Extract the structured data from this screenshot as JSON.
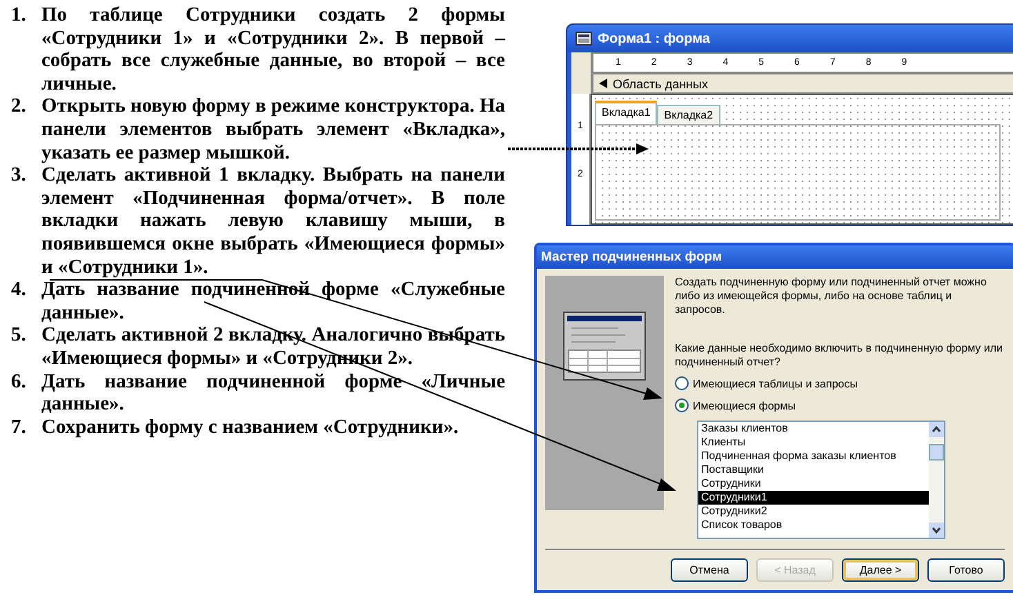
{
  "instructions": [
    {
      "number": "1.",
      "text": "По таблице Сотрудники создать 2 формы «Сотрудники 1» и «Сотрудники 2». В первой – собрать все служебные данные, во второй – все личные."
    },
    {
      "number": "2.",
      "text": "Открыть новую форму в режиме конструктора. На панели элементов выбрать элемент «Вкладка», указать ее размер мышкой."
    },
    {
      "number": "3.",
      "text": "Сделать активной 1 вкладку. Выбрать на панели элемент «Подчиненная форма/отчет». В поле вкладки нажать левую клавишу мыши, в появившемся окне выбрать «Имеющиеся формы» и «Сотрудники 1»."
    },
    {
      "number": "4.",
      "text": "Дать название подчиненной форме «Служебные данные»."
    },
    {
      "number": "5.",
      "text": "Сделать активной 2 вкладку. Аналогично выбрать «Имеющиеся формы» и «Сотрудники 2»."
    },
    {
      "number": "6.",
      "text": "Дать название подчиненной форме «Личные данные»."
    },
    {
      "number": "7.",
      "text": "Сохранить форму с названием «Сотрудники»."
    }
  ],
  "form_window": {
    "title": "Форма1 : форма",
    "ruler_marks": [
      "1",
      "2",
      "3",
      "4",
      "5",
      "6",
      "7",
      "8",
      "9"
    ],
    "vertical_marks": [
      "1",
      "2"
    ],
    "section": "Область данных",
    "tabs": [
      {
        "label": "Вкладка1",
        "selected": true
      },
      {
        "label": "Вкладка2",
        "selected": false
      }
    ]
  },
  "wizard": {
    "title": "Мастер подчиненных форм",
    "intro": "Создать подчиненную форму или подчиненный отчет можно либо из имеющейся формы, либо на основе таблиц и запросов.",
    "question": "Какие данные необходимо включить в подчиненную форму или подчиненный отчет?",
    "options": [
      {
        "label": "Имеющиеся таблицы и запросы",
        "selected": false
      },
      {
        "label": "Имеющиеся формы",
        "selected": true
      }
    ],
    "list_items": [
      {
        "label": "Заказы клиентов",
        "selected": false
      },
      {
        "label": "Клиенты",
        "selected": false
      },
      {
        "label": "Подчиненная форма заказы клиентов",
        "selected": false
      },
      {
        "label": "Поставщики",
        "selected": false
      },
      {
        "label": "Сотрудники",
        "selected": false
      },
      {
        "label": "Сотрудники1",
        "selected": true
      },
      {
        "label": "Сотрудники2",
        "selected": false
      },
      {
        "label": "Список товаров",
        "selected": false
      }
    ],
    "buttons": [
      {
        "label": "Отмена",
        "disabled": false,
        "default": false
      },
      {
        "label": "< Назад",
        "disabled": true,
        "default": false
      },
      {
        "label": "Далее >",
        "disabled": false,
        "default": true
      },
      {
        "label": "Готово",
        "disabled": false,
        "default": false
      }
    ]
  }
}
